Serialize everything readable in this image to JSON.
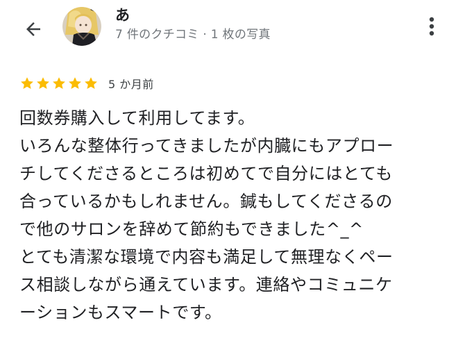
{
  "header": {
    "back_icon": "arrow-back-icon",
    "reviewer_name": "あ",
    "reviewer_meta": "7 件のクチコミ · 1 枚の写真",
    "more_icon": "more-vert-icon"
  },
  "rating": {
    "stars": 5,
    "max_stars": 5,
    "star_color": "#fbbc04",
    "time_ago": "5 か月前"
  },
  "review": {
    "lines": [
      "回数券購入して利用してます。",
      "いろんな整体行ってきましたが内臓にもアプロー",
      "チしてくださるところは初めてで自分にはとても",
      "合っているかもしれません。鍼もしてくださるの",
      "で他のサロンを辞めて節約もできました^_^",
      "とても清潔な環境で内容も満足して無理なくペー",
      "ス相談しながら通えています。連絡やコミュニケ",
      "ーションもスマートです。"
    ]
  }
}
